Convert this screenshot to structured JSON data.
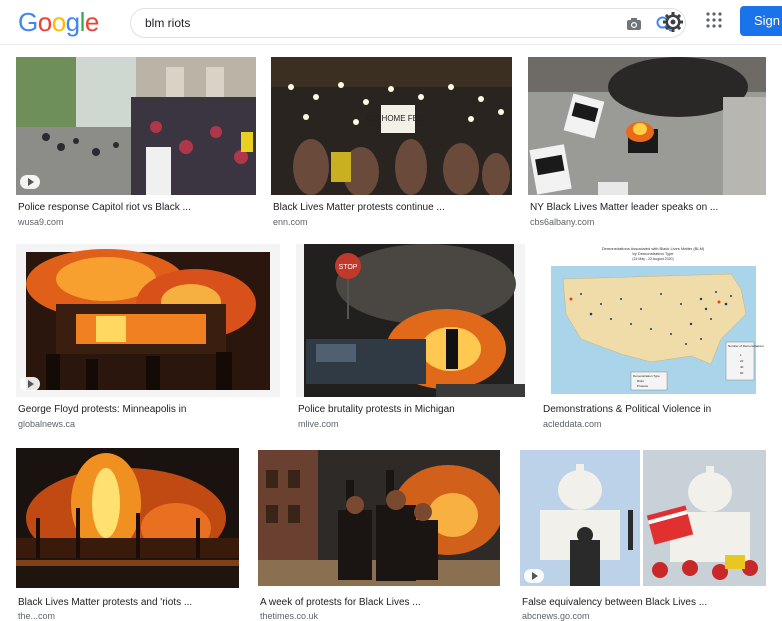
{
  "header": {
    "logo": [
      "G",
      "o",
      "o",
      "g",
      "l",
      "e"
    ],
    "logo_colors": [
      "#4285F4",
      "#EA4335",
      "#FBBC05",
      "#4285F4",
      "#34A853",
      "#EA4335"
    ],
    "search_value": "blm riots",
    "sign_in_label": "Sign"
  },
  "results": [
    {
      "title": "Police response Capitol riot vs Black ...",
      "source": "wusa9.com"
    },
    {
      "title": "Black Lives Matter protests continue ...",
      "source": "enn.com"
    },
    {
      "title": "NY Black Lives Matter leader speaks on ...",
      "source": "cbs6albany.com"
    },
    {
      "title": "George Floyd protests: Minneapolis in",
      "source": "globalnews.ca"
    },
    {
      "title": "Police brutality protests in Michigan",
      "source": "mlive.com"
    },
    {
      "title": "Demonstrations & Political Violence in",
      "source": "acleddata.com"
    },
    {
      "title": "Black Lives Matter protests and 'riots ...",
      "source": "the...com"
    },
    {
      "title": "A week of protests for Black Lives ...",
      "source": "thetimes.co.uk"
    },
    {
      "title": "False equivalency between Black Lives ...",
      "source": "abcnews.go.com"
    }
  ],
  "images": {
    "map_title": "Demonstrations Associated with Black Lives Matter (BLM)",
    "map_subtitle": "by Demonstration Type",
    "map_dates": "(24 May - 22 August 2020)",
    "map_legend_title": "Number of Demonstrations",
    "map_legend_values": [
      "1",
      "20",
      "40",
      "60"
    ],
    "map_type_title": "Demonstration Type",
    "map_type_items": [
      "Riots",
      "Protests"
    ],
    "sign_text": "GO HOME FEDS",
    "stop_text": "STOP"
  }
}
